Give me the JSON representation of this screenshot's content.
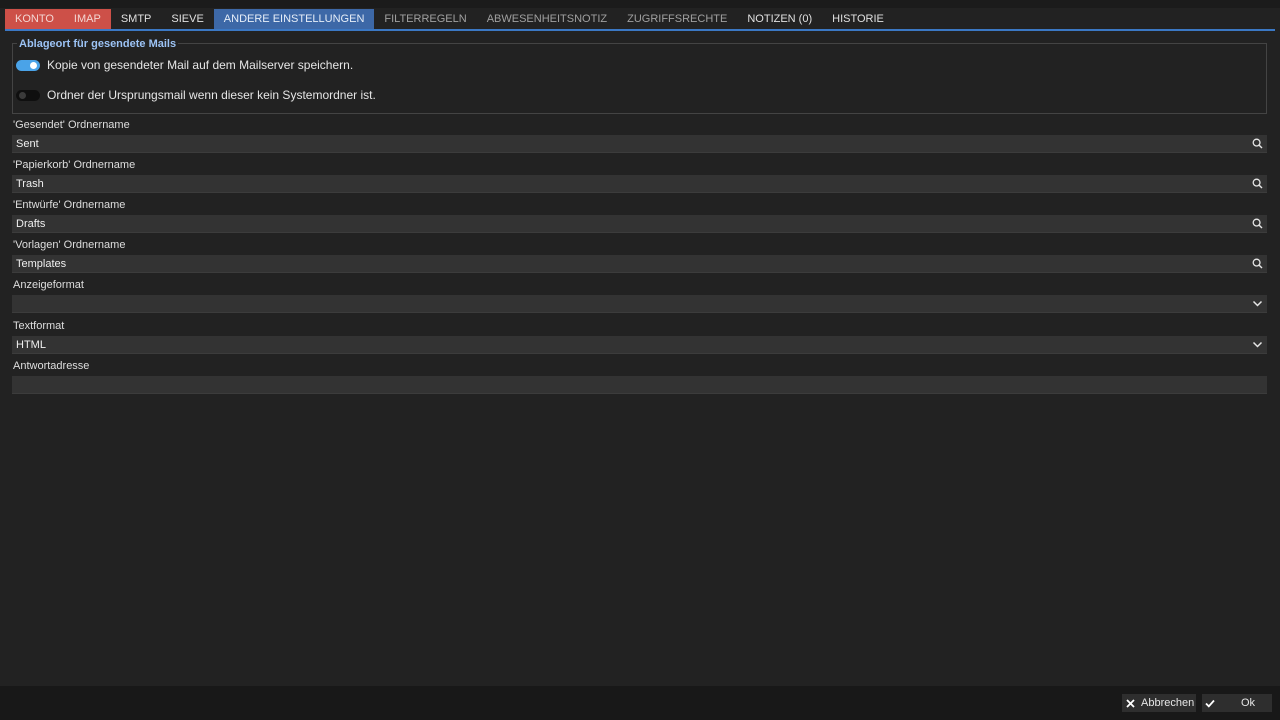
{
  "tabs": [
    {
      "label": "KONTO",
      "state": "error"
    },
    {
      "label": "IMAP",
      "state": "error"
    },
    {
      "label": "SMTP",
      "state": "normal"
    },
    {
      "label": "SIEVE",
      "state": "normal"
    },
    {
      "label": "ANDERE EINSTELLUNGEN",
      "state": "active"
    },
    {
      "label": "FILTERREGELN",
      "state": "dim"
    },
    {
      "label": "ABWESENHEITSNOTIZ",
      "state": "dim"
    },
    {
      "label": "ZUGRIFFSRECHTE",
      "state": "dim"
    },
    {
      "label": "NOTIZEN (0)",
      "state": "normal"
    },
    {
      "label": "HISTORIE",
      "state": "normal"
    }
  ],
  "sent_group": {
    "legend": "Ablageort für gesendete Mails",
    "toggles": [
      {
        "label": "Kopie von gesendeter Mail auf dem Mailserver speichern.",
        "on": true
      },
      {
        "label": "Ordner der Ursprungsmail wenn dieser kein Systemordner ist.",
        "on": false
      }
    ]
  },
  "fields": {
    "sent": {
      "label": "'Gesendet' Ordnername",
      "value": "Sent",
      "icon": "search-icon"
    },
    "trash": {
      "label": "'Papierkorb' Ordnername",
      "value": "Trash",
      "icon": "search-icon"
    },
    "drafts": {
      "label": "'Entwürfe' Ordnername",
      "value": "Drafts",
      "icon": "search-icon"
    },
    "templates": {
      "label": "'Vorlagen' Ordnername",
      "value": "Templates",
      "icon": "search-icon"
    },
    "display_format": {
      "label": "Anzeigeformat",
      "value": "",
      "icon": "chevron-down-icon"
    },
    "text_format": {
      "label": "Textformat",
      "value": "HTML",
      "icon": "chevron-down-icon"
    },
    "reply_address": {
      "label": "Antwortadresse",
      "value": ""
    }
  },
  "footer": {
    "cancel_label": "Abbrechen",
    "ok_label": "Ok"
  },
  "colors": {
    "background": "#222222",
    "accent": "#3b78c4",
    "active_tab": "#3d68a7",
    "error_tab": "#cd5048",
    "toggle_on": "#4aa3e8",
    "legend_text": "#9cc3f5"
  }
}
